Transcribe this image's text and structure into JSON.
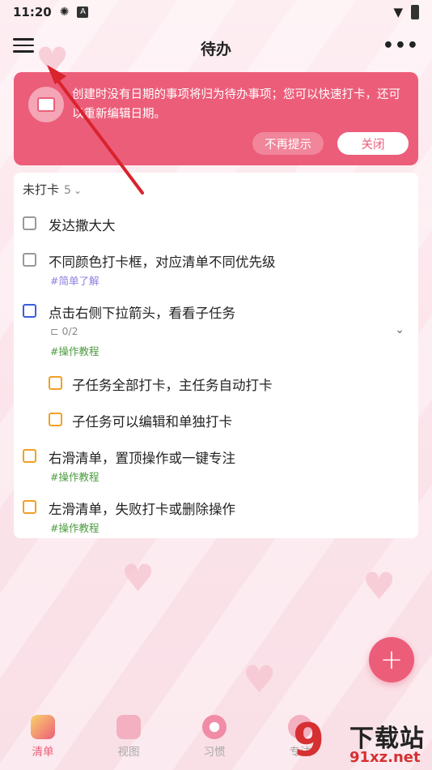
{
  "status_bar": {
    "time": "11:20",
    "icons": [
      "settings-icon",
      "a-icon",
      "wifi-icon",
      "battery-icon"
    ]
  },
  "header": {
    "title": "待办",
    "menu_icon": "hamburger-menu-icon",
    "more_icon": "more-dots-icon"
  },
  "banner": {
    "text": "创建时没有日期的事项将归为待办事项；您可以快速打卡，还可以重新编辑日期。",
    "no_remind_label": "不再提示",
    "close_label": "关闭",
    "color": "#ec5d79"
  },
  "list": {
    "section_title": "未打卡",
    "section_count": "5",
    "tasks": [
      {
        "title": "发达撒大大",
        "checkbox_color": "#999999"
      },
      {
        "title": "不同颜色打卡框，对应清单不同优先级",
        "tag": "#简单了解",
        "checkbox_color": "#999999"
      },
      {
        "title": "点击右侧下拉箭头，看看子任务",
        "subtask_progress": "0/2",
        "tag": "#操作教程",
        "checkbox_color": "#3a5ee0"
      },
      {
        "title": "子任务全部打卡，主任务自动打卡",
        "checkbox_color": "#f2a024",
        "is_subtask": true
      },
      {
        "title": "子任务可以编辑和单独打卡",
        "checkbox_color": "#f2a024",
        "is_subtask": true
      },
      {
        "title": "右滑清单，置顶操作或一键专注",
        "tag": "#操作教程",
        "checkbox_color": "#f2a024"
      },
      {
        "title": "左滑清单，失败打卡或删除操作",
        "tag": "#操作教程",
        "checkbox_color": "#f2a024"
      }
    ]
  },
  "fab": {
    "label": "+"
  },
  "bottom_nav": {
    "items": [
      {
        "label": "清单",
        "icon": "gift-list-icon",
        "active": true
      },
      {
        "label": "视图",
        "icon": "envelope-view-icon",
        "active": false
      },
      {
        "label": "习惯",
        "icon": "donut-habit-icon",
        "active": false
      },
      {
        "label": "专注",
        "icon": "balloon-focus-icon",
        "active": false
      }
    ]
  },
  "watermark": {
    "logo": "9",
    "title": "下载站",
    "url": "91xz.net"
  }
}
